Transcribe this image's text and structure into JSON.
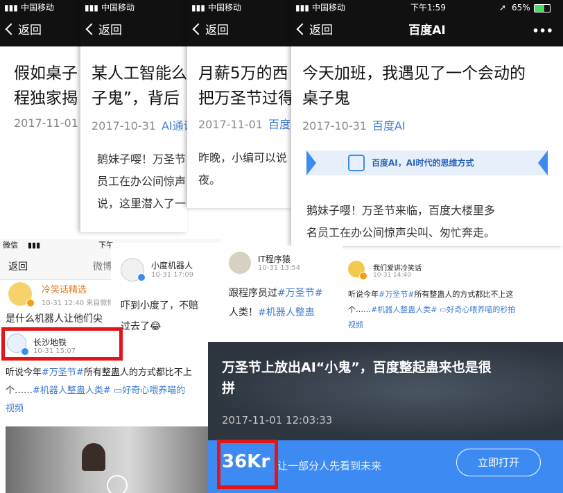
{
  "screens": {
    "s1": {
      "carrier": "中国移动",
      "back_label": "返回",
      "title_line1": "假如桌子",
      "title_line2": "程独家揭",
      "date": "2017-11-01"
    },
    "s2": {
      "carrier": "中国移动",
      "back_label": "返回",
      "title_line1": "某人工智能么",
      "title_line2": "子鬼”，背后",
      "date": "2017-10-31",
      "source": "AI通讯",
      "body_line1": "鹅妹子嘤！万圣节",
      "body_line2": "员工在办公间惊声",
      "body_line3": "说，这里潜入了一"
    },
    "s3": {
      "carrier": "中国移动",
      "back_label": "返回",
      "title_line1": "月薪5万的西",
      "title_line2": "把万圣节过得",
      "date": "2017-11-01",
      "source": "百度",
      "body_line1": "昨晚，小编可以说",
      "body_line2": "夜。"
    },
    "s4": {
      "carrier": "中国移动",
      "time": "下午1:59",
      "battery": "65%",
      "back_label": "返回",
      "nav_title": "百度AI",
      "more": "•••",
      "title_line1": "今天加班，我遇见了一个会动的",
      "title_line2": "桌子鬼",
      "date": "2017-10-31",
      "source": "百度AI",
      "banner_text": "百度AI，AI时代的思维方式",
      "body_line1": "鹅妹子嘤！万圣节来临，百度大楼里多",
      "body_line2": "名员工在办公间惊声尖叫、匆忙奔走。"
    }
  },
  "weibo": {
    "w1": {
      "status_app": "微信",
      "status_time": "下午",
      "back_label": "返回",
      "nav_title": "微博",
      "user1_name": "冷笑话精选",
      "user1_time": "10-31 12:40",
      "user1_via": "来自微博",
      "user1_text": "是什么机器人让他们尖",
      "user2_name": "长沙地铁",
      "user2_time": "10-31 15:07",
      "text_prefix": "听说今年",
      "tag1": "#万圣节#",
      "text_mid": "所有整蛊人的方式都比不上",
      "text_line2_prefix": "个……",
      "tag2": "#机器人整蛊人类#",
      "video_label": "好奇心喂养喵的",
      "text_line3": "视频"
    },
    "w2": {
      "user_name": "小度机器人",
      "user_time": "10-31 17:09",
      "text_line1": "吓到小度了，不赔",
      "text_line2": "过去了😂"
    },
    "w3": {
      "user_name": "IT程序猿",
      "user_time": "10-31 13:54",
      "text_prefix": "跟程序员过",
      "tag1": "#万圣节#",
      "text_line2_prefix": "人类！",
      "tag2": "#机器人整蛊"
    },
    "w4": {
      "user_name": "我们爱讲冷笑话",
      "user_time": "10-31 14:40",
      "text_prefix": "听说今年",
      "tag1": "#万圣节#",
      "text_mid": "所有整蛊人的方式都比不上这",
      "text_line2_prefix": "个……",
      "tag2": "#机器人整蛊人类#",
      "video_label": "好奇心喂养喵的秒拍",
      "text_line3": "视频"
    }
  },
  "kr": {
    "headline_line1": "万圣节上放出AI“小鬼”，百度整起蛊来也是很",
    "headline_line2": "拼",
    "datetime": "2017-11-01 12:03:33",
    "logo_text": "36Kr",
    "slogan": "让一部分人先看到未来",
    "open_button": "立即打开"
  },
  "colors": {
    "link": "#3e7bd1",
    "highlight_box": "#e0161a",
    "kr_bar": "#3d8bf2",
    "kr_bg": "#2e3640"
  }
}
